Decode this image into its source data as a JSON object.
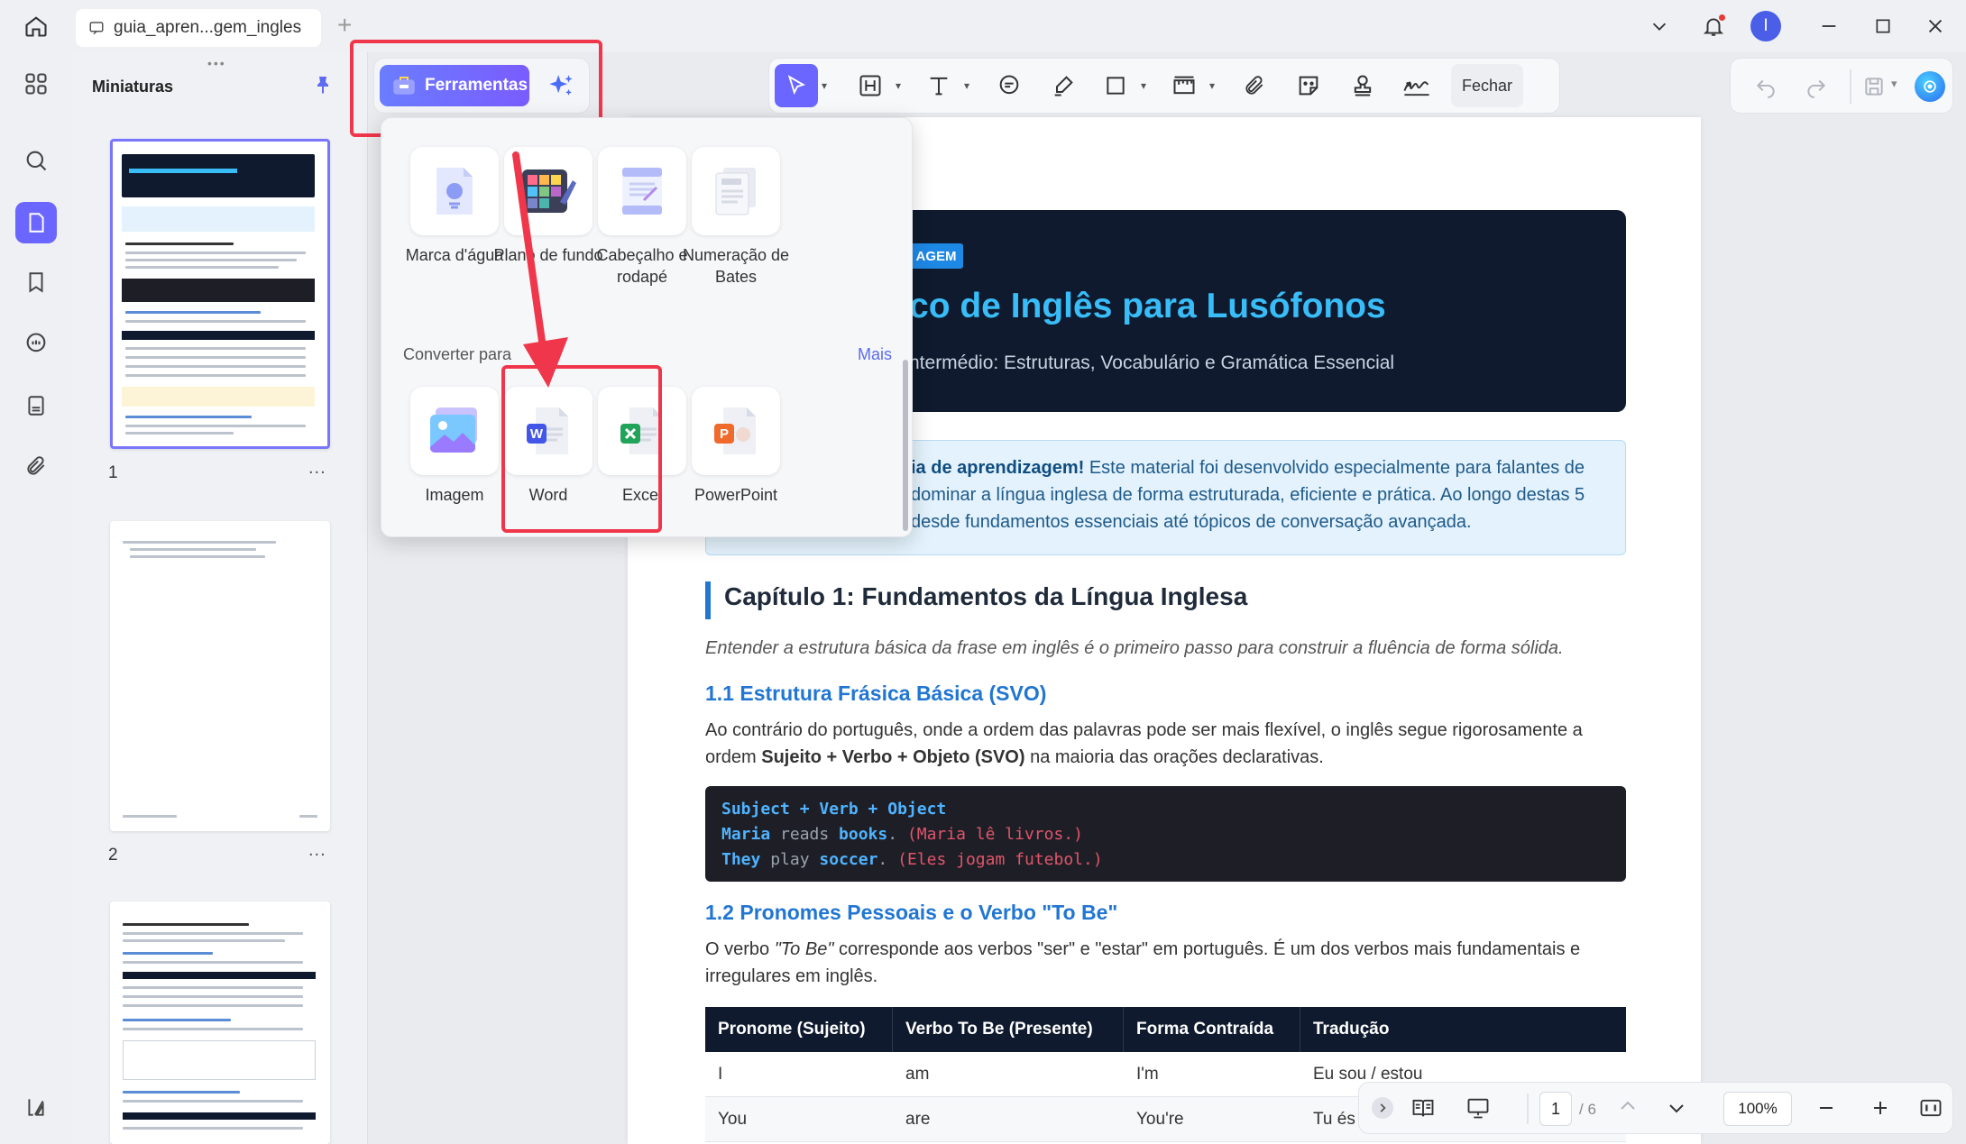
{
  "window": {
    "tab_title": "guia_apren...gem_ingles",
    "avatar_initial": "I"
  },
  "thumbnails": {
    "title": "Miniaturas",
    "pages": [
      {
        "number": "1",
        "more": "..."
      },
      {
        "number": "2",
        "more": "..."
      }
    ]
  },
  "tools_button": {
    "label": "Ferramentas"
  },
  "toolbar": {
    "close_label": "Fechar"
  },
  "dropdown": {
    "items": [
      {
        "label": "Marca d'água",
        "icon": "watermark-icon"
      },
      {
        "label": "Plano de fundo",
        "icon": "background-icon"
      },
      {
        "label": "Cabeçalho e rodapé",
        "icon": "header-footer-icon"
      },
      {
        "label": "Numeração de Bates",
        "icon": "bates-numbering-icon"
      }
    ],
    "convert_section": "Converter para",
    "more_label": "Mais",
    "convert_items": [
      {
        "label": "Imagem",
        "icon": "image-icon"
      },
      {
        "label": "Word",
        "icon": "word-icon"
      },
      {
        "label": "Excel",
        "icon": "excel-icon"
      },
      {
        "label": "PowerPoint",
        "icon": "powerpoint-icon"
      }
    ]
  },
  "document": {
    "badge": "AGEM",
    "title": "co de Inglês para Lusófonos",
    "subtitle": "ntermédio: Estruturas, Vocabulário e Gramática Essencial",
    "intro_bold": "ia de aprendizagem!",
    "intro_line1": " Este material foi desenvolvido especialmente para falantes de",
    "intro_line2": " dominar a língua inglesa de forma estruturada, eficiente e prática. Ao longo destas 5",
    "intro_line3": "desde fundamentos essenciais até tópicos de conversação avançada.",
    "chapter1": "Capítulo 1: Fundamentos da Língua Inglesa",
    "chapter1_lead": "Entender a estrutura básica da frase em inglês é o primeiro passo para construir a fluência de forma sólida.",
    "s11_title": "1.1 Estrutura Frásica Básica (SVO)",
    "s11_p1": "Ao contrário do português, onde a ordem das palavras pode ser mais flexível, o inglês segue rigorosamente a",
    "s11_p2a": "ordem ",
    "s11_p2b": "Sujeito + Verbo + Objeto (SVO)",
    "s11_p2c": " na maioria das orações declarativas.",
    "code": {
      "line1": "Subject + Verb + Object",
      "l2_subj": "Maria",
      "l2_verb": " reads ",
      "l2_obj": "books",
      "l2_dot": ".",
      "l2_tr": " (Maria lê livros.)",
      "l3_subj": "They",
      "l3_verb": " play ",
      "l3_obj": "soccer",
      "l3_dot": ".",
      "l3_tr": " (Eles jogam futebol.)"
    },
    "s12_title": "1.2 Pronomes Pessoais e o Verbo \"To Be\"",
    "s12_p1a": "O verbo ",
    "s12_p1b": "\"To Be\"",
    "s12_p1c": " corresponde aos verbos \"ser\" e \"estar\" em português. É um dos verbos mais fundamentais e",
    "s12_p2": "irregulares em inglês.",
    "table": {
      "headers": [
        "Pronome (Sujeito)",
        "Verbo To Be (Presente)",
        "Forma Contraída",
        "Tradução"
      ],
      "rows": [
        [
          "I",
          "am",
          "I'm",
          "Eu sou / estou"
        ],
        [
          "You",
          "are",
          "You're",
          "Tu és"
        ]
      ]
    }
  },
  "bottombar": {
    "page_current": "1",
    "page_total": "/ 6",
    "zoom": "100%"
  }
}
